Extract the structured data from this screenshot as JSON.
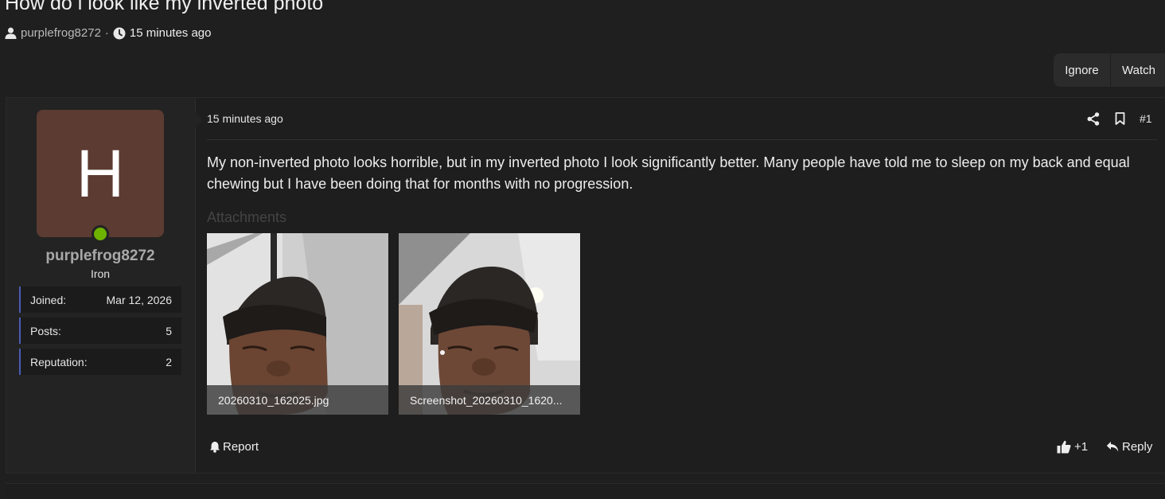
{
  "thread": {
    "title": "How do i look like my inverted photo",
    "author": "purplefrog8272",
    "separator": "·",
    "time": "15 minutes ago"
  },
  "actions": {
    "ignore_label": "Ignore",
    "watch_label": "Watch"
  },
  "post": {
    "user": {
      "avatar_letter": "H",
      "avatar_color": "#5b3b32",
      "online_color": "#6db300",
      "username": "purplefrog8272",
      "title": "Iron",
      "stats": [
        {
          "label": "Joined:",
          "value": "Mar 12, 2026"
        },
        {
          "label": "Posts:",
          "value": "5"
        },
        {
          "label": "Reputation:",
          "value": "2"
        }
      ]
    },
    "date": "15 minutes ago",
    "number": "#1",
    "body": "My non-inverted photo looks horrible, but in my inverted photo I look significantly better. Many people have told me to sleep on my back and equal chewing but I have been doing that for months with no progression.",
    "attachments_label": "Attachments",
    "attachments": [
      {
        "filename": "20260310_162025.jpg"
      },
      {
        "filename": "Screenshot_20260310_1620..."
      }
    ],
    "report_label": "Report",
    "reaction_count": "+1",
    "reply_label": "Reply"
  },
  "icons": {
    "user": "user-icon",
    "clock": "clock-icon",
    "share": "share-icon",
    "bookmark": "bookmark-icon",
    "bell": "bell-icon",
    "thumbs_up": "thumbs-up-icon",
    "reply": "reply-icon"
  },
  "colors": {
    "background": "#1f1f1f",
    "stat_accent": "#4a5db5"
  }
}
